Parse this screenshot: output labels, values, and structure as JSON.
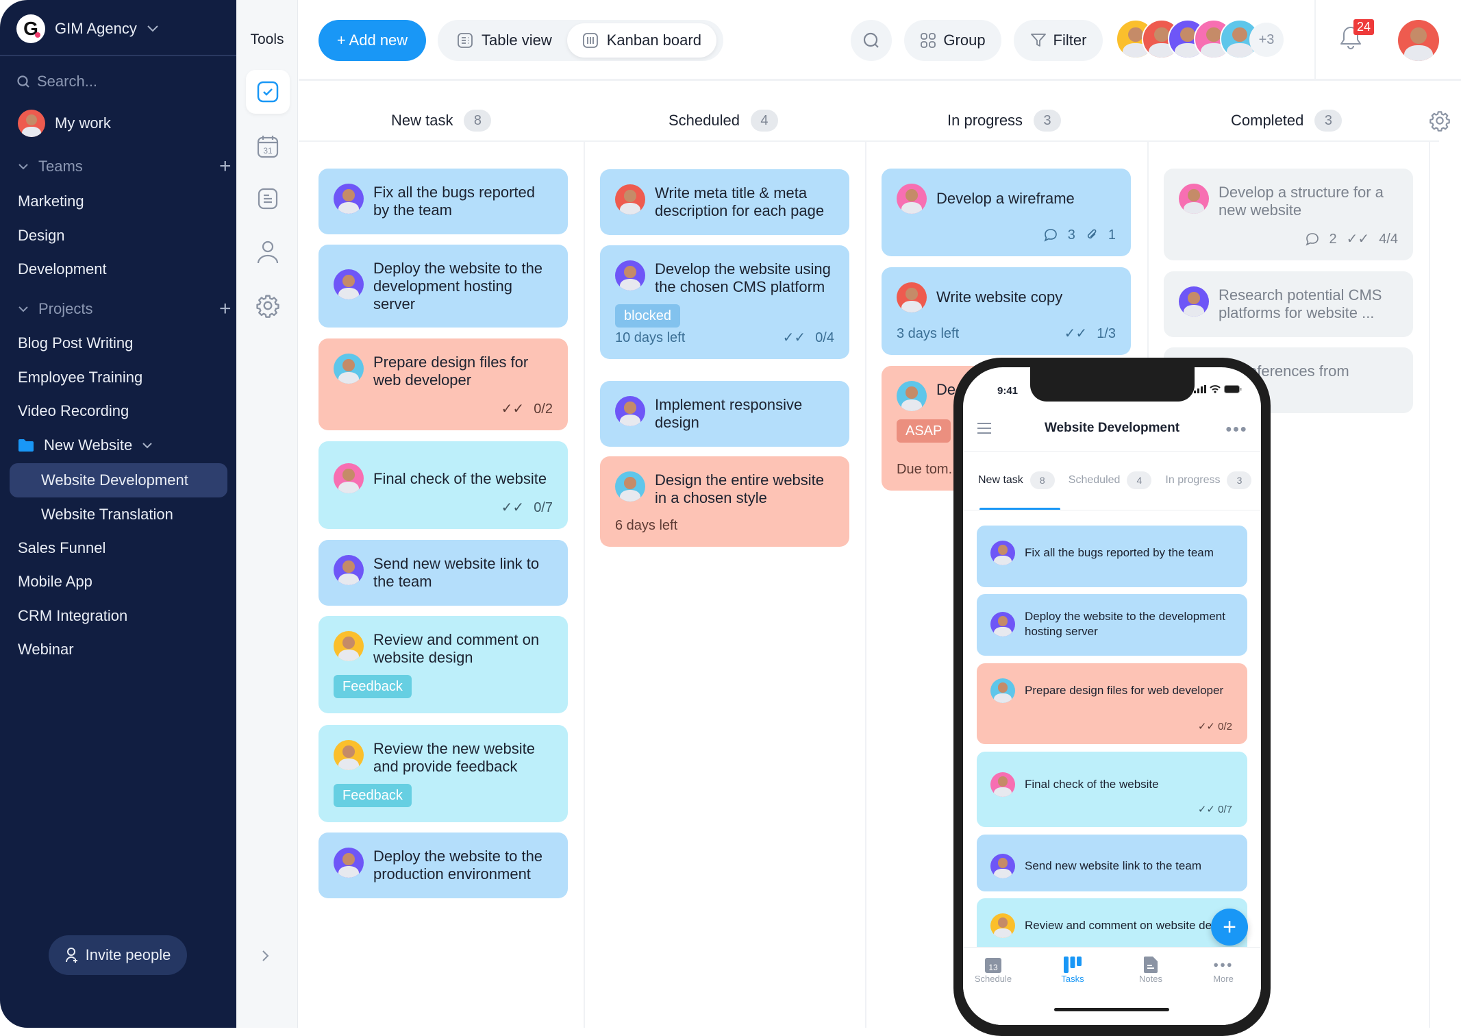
{
  "sidebar": {
    "workspace": "GIM Agency",
    "logo_letter": "G",
    "search_placeholder": "Search...",
    "my_work": "My work",
    "teams_label": "Teams",
    "teams": [
      "Marketing",
      "Design",
      "Development"
    ],
    "projects_label": "Projects",
    "projects": [
      "Blog Post Writing",
      "Employee Training",
      "Video Recording"
    ],
    "folder": "New Website",
    "folder_items": [
      "Website Development",
      "Website Translation"
    ],
    "active_item": "Website Development",
    "projects_more": [
      "Sales Funnel",
      "Mobile App",
      "CRM Integration",
      "Webinar"
    ],
    "invite": "Invite people"
  },
  "tools": {
    "label": "Tools",
    "calendar_day": "31"
  },
  "header": {
    "add_new": "+ Add new",
    "table_view": "Table view",
    "kanban_board": "Kanban board",
    "group": "Group",
    "filter": "Filter",
    "more_members": "+3",
    "notifications": "24"
  },
  "columns": [
    {
      "name": "New task",
      "count": "8"
    },
    {
      "name": "Scheduled",
      "count": "4"
    },
    {
      "name": "In progress",
      "count": "3"
    },
    {
      "name": "Completed",
      "count": "3"
    }
  ],
  "cards": {
    "new_task": [
      {
        "title": "Fix all the bugs reported by the team"
      },
      {
        "title": "Deploy the website to the development hosting server"
      },
      {
        "title": "Prepare design files for web developer",
        "checklist": "0/2"
      },
      {
        "title": "Final check of the website",
        "checklist": "0/7"
      },
      {
        "title": "Send new website link to the team"
      },
      {
        "title": "Review and comment on website design",
        "tag": "Feedback"
      },
      {
        "title": "Review the new website and provide feedback",
        "tag": "Feedback"
      },
      {
        "title": "Deploy the website to the production environment"
      }
    ],
    "scheduled": [
      {
        "title": "Write meta title & meta description for each page"
      },
      {
        "title": "Develop the website using the chosen CMS platform",
        "tag": "blocked",
        "due": "10 days left",
        "checklist": "0/4"
      },
      {
        "title": "Implement responsive design"
      },
      {
        "title": "Design the entire website in a chosen style",
        "due": "6 days left"
      }
    ],
    "in_progress": [
      {
        "title": "Develop a wireframe",
        "comments": "3",
        "attachments": "1"
      },
      {
        "title": "Write website copy",
        "due": "3 days left",
        "checklist": "1/3"
      },
      {
        "title": "De... dif...",
        "tag": "ASAP",
        "due": "Due tom..."
      }
    ],
    "completed": [
      {
        "title": "Develop a structure for a new website",
        "comments": "2",
        "checklist": "4/4"
      },
      {
        "title": "Research potential CMS platforms for website ..."
      },
      {
        "title": "...0 references from ...ustry"
      }
    ]
  },
  "phone": {
    "time": "9:41",
    "title": "Website Development",
    "tabs": [
      {
        "name": "New task",
        "count": "8"
      },
      {
        "name": "Scheduled",
        "count": "4"
      },
      {
        "name": "In progress",
        "count": "3"
      }
    ],
    "cards": [
      {
        "title": "Fix all the bugs reported by the team"
      },
      {
        "title": "Deploy the website to the development hosting server"
      },
      {
        "title": "Prepare design files for web developer",
        "checklist": "0/2"
      },
      {
        "title": "Final check of the website",
        "checklist": "0/7"
      },
      {
        "title": "Send new website link to the team"
      },
      {
        "title": "Review and comment on website design"
      }
    ],
    "nav": [
      {
        "label": "Schedule",
        "day": "13"
      },
      {
        "label": "Tasks"
      },
      {
        "label": "Notes"
      },
      {
        "label": "More"
      }
    ]
  },
  "colors": {
    "accent": "#1997f6",
    "sidebar": "#111e41",
    "card_blue": "#b4defb",
    "card_cyan": "#bdeffa",
    "card_salmon": "#fdc3b5",
    "card_grey": "#eff2f4",
    "badge": "#ee3a3a"
  }
}
